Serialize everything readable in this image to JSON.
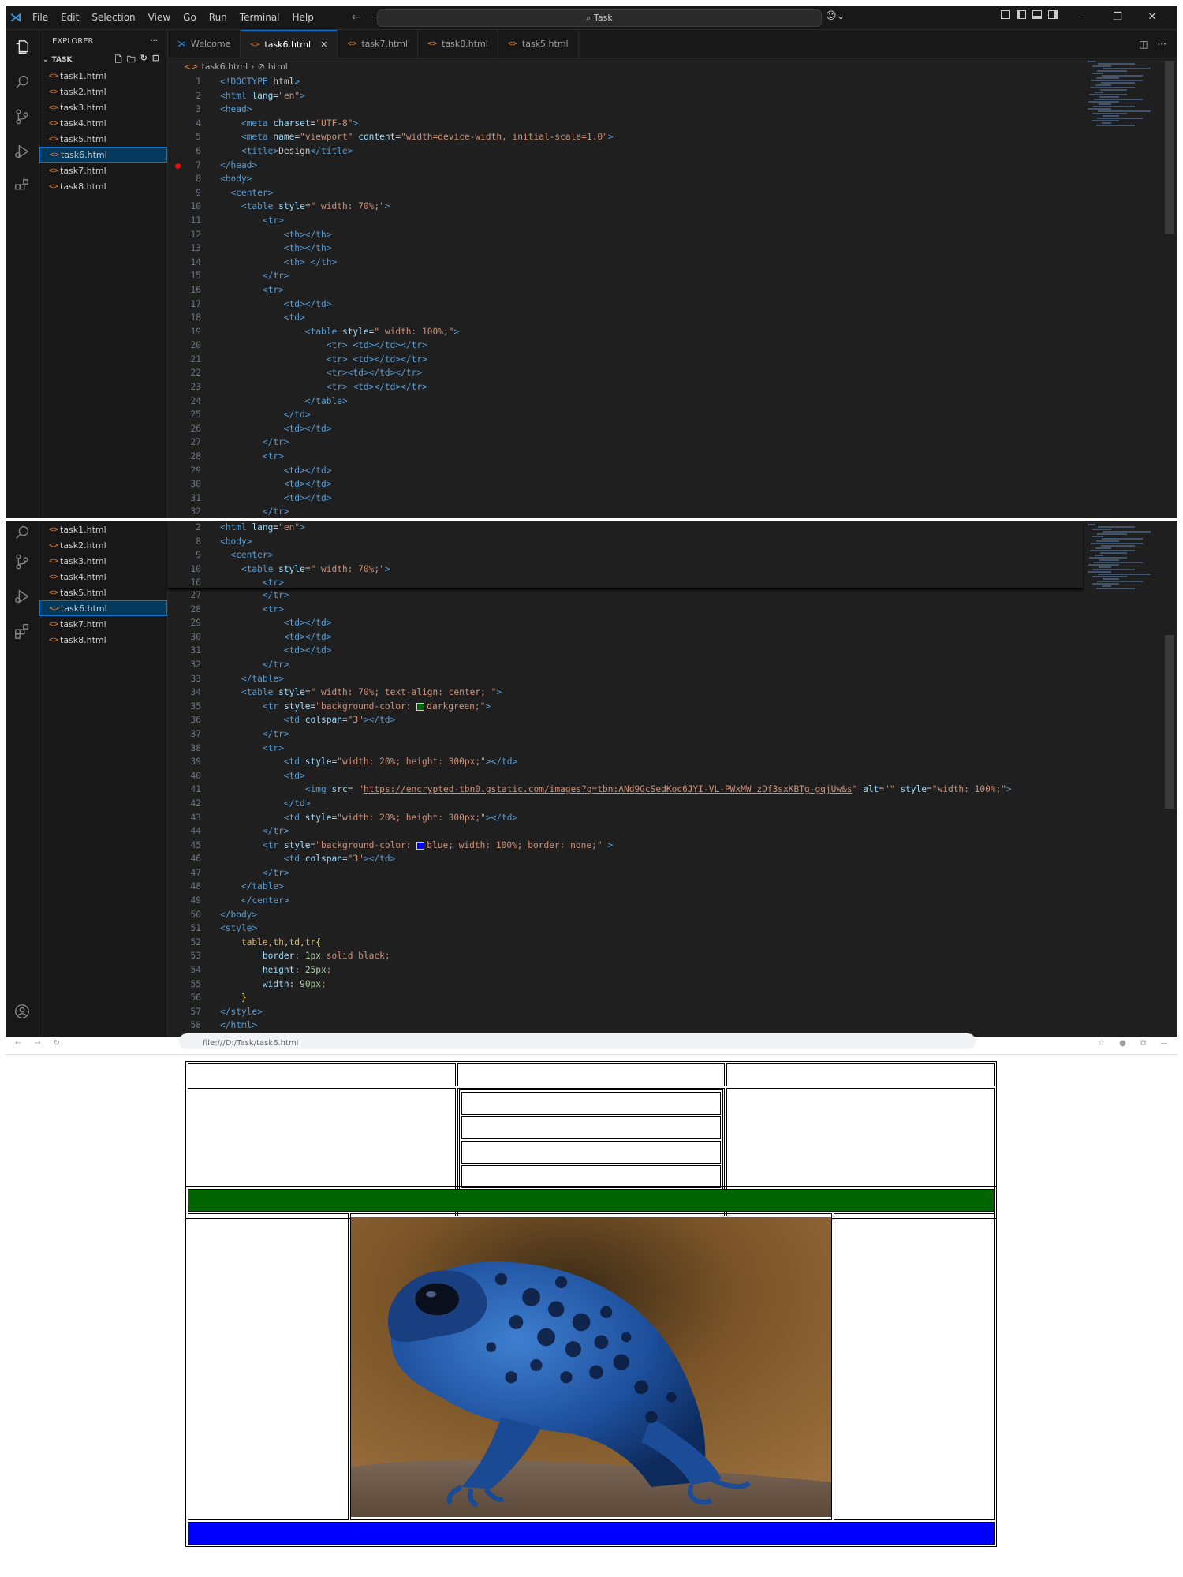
{
  "window": {
    "menu": [
      "File",
      "Edit",
      "Selection",
      "View",
      "Go",
      "Run",
      "Terminal",
      "Help"
    ],
    "search": "Task",
    "controls": [
      "–",
      "❐",
      "✕"
    ]
  },
  "sidebar": {
    "title": "EXPLORER",
    "folder": "TASK",
    "files": [
      "task1.html",
      "task2.html",
      "task3.html",
      "task4.html",
      "task5.html",
      "task6.html",
      "task7.html",
      "task8.html"
    ],
    "active_file": "task6.html"
  },
  "tabs": [
    "Welcome",
    "task6.html",
    "task7.html",
    "task8.html",
    "task5.html"
  ],
  "active_tab": "task6.html",
  "breadcrumb": [
    "task6.html",
    "html"
  ],
  "editor1": {
    "lines": [
      {
        "n": "1",
        "text": "<!DOCTYPE html>"
      },
      {
        "n": "2",
        "text": "<html lang=\"en\">"
      },
      {
        "n": "3",
        "text": "<head>"
      },
      {
        "n": "4",
        "text": "    <meta charset=\"UTF-8\">"
      },
      {
        "n": "5",
        "text": "    <meta name=\"viewport\" content=\"width=device-width, initial-scale=1.0\">"
      },
      {
        "n": "6",
        "text": "    <title>Design</title>"
      },
      {
        "n": "7",
        "text": "</head>"
      },
      {
        "n": "8",
        "text": "<body>"
      },
      {
        "n": "9",
        "text": "  <center>"
      },
      {
        "n": "10",
        "text": "    <table style=\" width: 70%;\">"
      },
      {
        "n": "11",
        "text": "        <tr>"
      },
      {
        "n": "12",
        "text": "            <th></th>"
      },
      {
        "n": "13",
        "text": "            <th></th>"
      },
      {
        "n": "14",
        "text": "            <th> </th>"
      },
      {
        "n": "15",
        "text": "        </tr>"
      },
      {
        "n": "16",
        "text": "        <tr>"
      },
      {
        "n": "17",
        "text": "            <td></td>"
      },
      {
        "n": "18",
        "text": "            <td>"
      },
      {
        "n": "19",
        "text": "                <table style=\" width: 100%;\">"
      },
      {
        "n": "20",
        "text": "                    <tr> <td></td></tr>"
      },
      {
        "n": "21",
        "text": "                    <tr> <td></td></tr>"
      },
      {
        "n": "22",
        "text": "                    <tr><td></td></tr>"
      },
      {
        "n": "23",
        "text": "                    <tr> <td></td></tr>"
      },
      {
        "n": "24",
        "text": "                </table>"
      },
      {
        "n": "25",
        "text": "            </td>"
      },
      {
        "n": "26",
        "text": "            <td></td>"
      },
      {
        "n": "27",
        "text": "        </tr>"
      },
      {
        "n": "28",
        "text": "        <tr>"
      },
      {
        "n": "29",
        "text": "            <td></td>"
      },
      {
        "n": "30",
        "text": "            <td></td>"
      },
      {
        "n": "31",
        "text": "            <td></td>"
      },
      {
        "n": "32",
        "text": "        </tr>"
      }
    ]
  },
  "editor2": {
    "sticky": [
      {
        "n": "2",
        "text": "<html lang=\"en\">"
      },
      {
        "n": "8",
        "text": "<body>"
      },
      {
        "n": "9",
        "text": "  <center>"
      },
      {
        "n": "10",
        "text": "    <table style=\" width: 70%;\">"
      },
      {
        "n": "16",
        "text": "        <tr>"
      }
    ],
    "lines": [
      {
        "n": "27",
        "text": "        </tr>"
      },
      {
        "n": "28",
        "text": "        <tr>"
      },
      {
        "n": "29",
        "text": "            <td></td>"
      },
      {
        "n": "30",
        "text": "            <td></td>"
      },
      {
        "n": "31",
        "text": "            <td></td>"
      },
      {
        "n": "32",
        "text": "        </tr>"
      },
      {
        "n": "33",
        "text": "    </table>"
      },
      {
        "n": "34",
        "text": "    <table style=\" width: 70%; text-align: center; \">"
      },
      {
        "n": "35",
        "text": "        <tr style=\"background-color: darkgreen;\">"
      },
      {
        "n": "36",
        "text": "            <td colspan=\"3\"></td>"
      },
      {
        "n": "37",
        "text": "        </tr>"
      },
      {
        "n": "38",
        "text": "        <tr>"
      },
      {
        "n": "39",
        "text": "            <td style=\"width: 20%; height: 300px;\"></td>"
      },
      {
        "n": "40",
        "text": "            <td>"
      },
      {
        "n": "41",
        "text": "                <img src= \"https://encrypted-tbn0.gstatic.com/images?q=tbn:ANd9GcSedKoc6JYI-VL-PWxMW_zDf3sxKBTg-gqjUw&s\" alt=\"\" style=\"width: 100%;\">"
      },
      {
        "n": "42",
        "text": "            </td>"
      },
      {
        "n": "43",
        "text": "            <td style=\"width: 20%; height: 300px;\"></td>"
      },
      {
        "n": "44",
        "text": "        </tr>"
      },
      {
        "n": "45",
        "text": "        <tr style=\"background-color: blue; width: 100%; border: none;\" >"
      },
      {
        "n": "46",
        "text": "            <td colspan=\"3\"></td>"
      },
      {
        "n": "47",
        "text": "        </tr>"
      },
      {
        "n": "48",
        "text": "    </table>"
      },
      {
        "n": "49",
        "text": "    </center>"
      },
      {
        "n": "50",
        "text": "</body>"
      },
      {
        "n": "51",
        "text": "<style>"
      },
      {
        "n": "52",
        "text": "    table,th,td,tr{"
      },
      {
        "n": "53",
        "text": "        border: 1px solid black;"
      },
      {
        "n": "54",
        "text": "        height: 25px;"
      },
      {
        "n": "55",
        "text": "        width: 90px;"
      },
      {
        "n": "56",
        "text": "    }"
      },
      {
        "n": "57",
        "text": "</style>"
      },
      {
        "n": "58",
        "text": "</html>"
      }
    ]
  },
  "browser": {
    "url": "file:///D:/Task/task6.html",
    "green_row_color": "#006400",
    "blue_row_color": "#0000ff",
    "image_subject": "blue poison dart frog"
  },
  "colors": {
    "editor_bg": "#1f1f1f",
    "sidebar_bg": "#181818",
    "accent": "#0078d4",
    "html_icon": "#e37933"
  }
}
